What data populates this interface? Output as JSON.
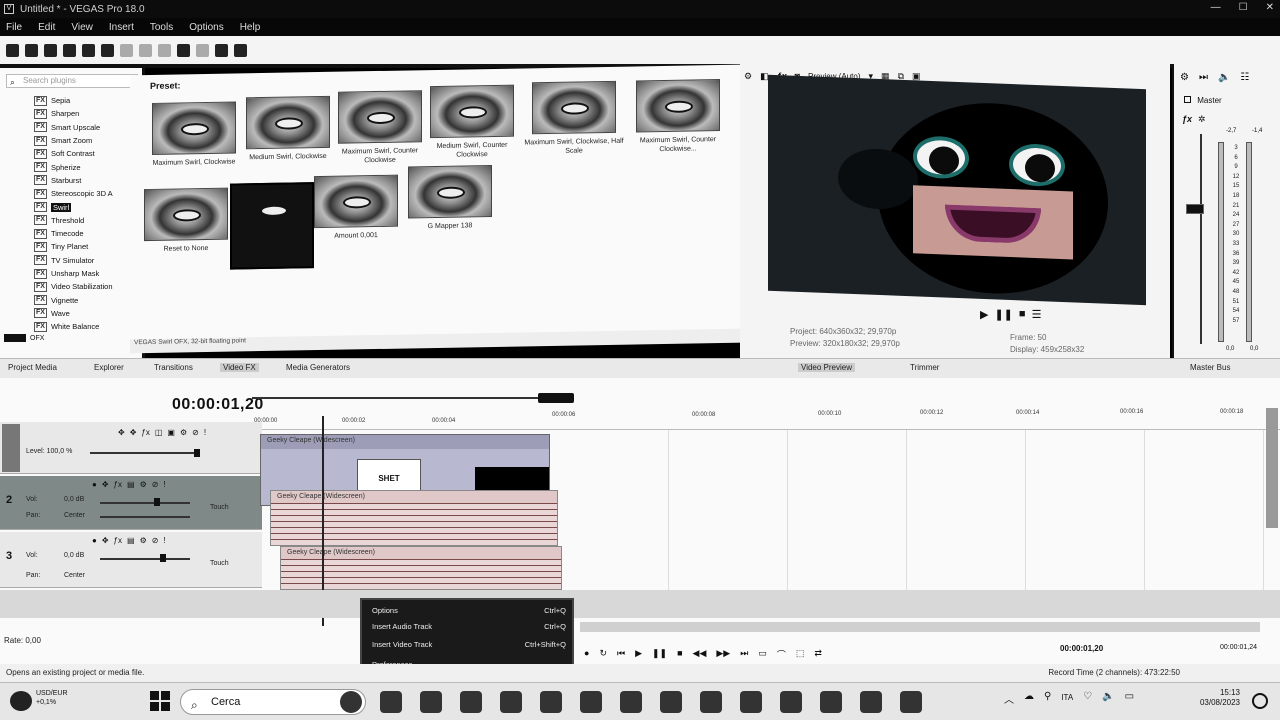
{
  "window": {
    "title": "Untitled * - VEGAS Pro 18.0",
    "controls": [
      "—",
      "☐",
      "✕"
    ]
  },
  "menu": [
    "File",
    "Edit",
    "View",
    "Insert",
    "Tools",
    "Options",
    "Help"
  ],
  "plugins": {
    "search_placeholder": "Search plugins",
    "items": [
      "Sepia",
      "Sharpen",
      "Smart Upscale",
      "Smart Zoom",
      "Soft Contrast",
      "Spherize",
      "Starburst",
      "Stereoscopic 3D A",
      "Swirl",
      "Threshold",
      "Timecode",
      "Tiny Planet",
      "TV Simulator",
      "Unsharp Mask",
      "Video Stabilization",
      "Vignette",
      "Wave",
      "White Balance"
    ],
    "selected": "Swirl",
    "footer": "OFX"
  },
  "presets": {
    "label": "Preset:",
    "items": [
      "Maximum Swirl, Clockwise",
      "Medium Swirl, Clockwise",
      "Maximum Swirl, Counter Clockwise",
      "Medium Swirl, Counter Clockwise",
      "Maximum Swirl, Clockwise, Half Scale",
      "Maximum Swirl, Counter Clockwise...",
      "Reset to None",
      "",
      "Amount 0,001",
      "G Mapper 138"
    ],
    "status": "VEGAS Swirl OFX, 32-bit floating point"
  },
  "preview": {
    "mode": "Preview (Auto)",
    "project": "Project:  640x360x32; 29,970p",
    "preview_res": "Preview:  320x180x32; 29,970p",
    "frame": "Frame:  50",
    "display": "Display:  459x258x32",
    "transport": [
      "▶",
      "❚❚",
      "■",
      "☰"
    ]
  },
  "master": {
    "label": "Master",
    "peak_left": "-2,7",
    "peak_right": "-1,4",
    "scale": [
      "3",
      "6",
      "9",
      "12",
      "15",
      "18",
      "21",
      "24",
      "27",
      "30",
      "33",
      "36",
      "39",
      "42",
      "45",
      "48",
      "51",
      "54",
      "57"
    ],
    "bottom_left": "0,0",
    "bottom_right": "0,0"
  },
  "tabs": {
    "left": [
      "Project Media",
      "Explorer",
      "Transitions",
      "Video FX",
      "Media Generators"
    ],
    "active": "Video FX",
    "preview_tabs": [
      "Video Preview",
      "Trimmer"
    ],
    "master_tab": "Master Bus"
  },
  "timeline": {
    "timecode": "00:00:01,20",
    "ruler": [
      "00:00:00",
      "00:00:02",
      "00:00:04",
      "00:00:06",
      "00:00:08",
      "00:00:10",
      "00:00:12",
      "00:00:14",
      "00:00:16",
      "00:00:18",
      "00:00:20"
    ],
    "tracks": [
      {
        "num": "1",
        "level": "Level: 100,0 %"
      },
      {
        "num": "2",
        "vol_label": "Vol:",
        "vol": "0,0 dB",
        "pan_label": "Pan:",
        "pan": "Center",
        "touch": "Touch"
      },
      {
        "num": "3",
        "vol_label": "Vol:",
        "vol": "0,0 dB",
        "pan_label": "Pan:",
        "pan": "Center",
        "touch": "Touch"
      }
    ],
    "clips": {
      "video": "Geeky Cleape (Widescreen)",
      "audio1": "Geeky Cleape (Widescreen)",
      "audio2": "Geeky Cleape (Widescreen)",
      "frame_text": "SHET"
    },
    "rate": "Rate: 0,00",
    "time_readout": "00:00:01,20",
    "time_readout2": "00:00:01,24"
  },
  "context_menu": {
    "items": [
      {
        "label": "Insert Audio Track",
        "shortcut": "Ctrl+Q"
      },
      {
        "label": "Insert Video Track",
        "shortcut": "Ctrl+Shift+Q"
      },
      {
        "label": "Preferences...",
        "shortcut": ""
      }
    ],
    "header_left": "Options",
    "header_right": "Ctrl+Q"
  },
  "status": {
    "left": "Opens an existing project or media file.",
    "right": "Record Time (2 channels): 473:22:50"
  },
  "taskbar": {
    "weather_line1": "USD/EUR",
    "weather_line2": "+0,1%",
    "search": "Cerca",
    "tray_lang": "ITA",
    "time": "15:13",
    "date": "03/08/2023"
  }
}
